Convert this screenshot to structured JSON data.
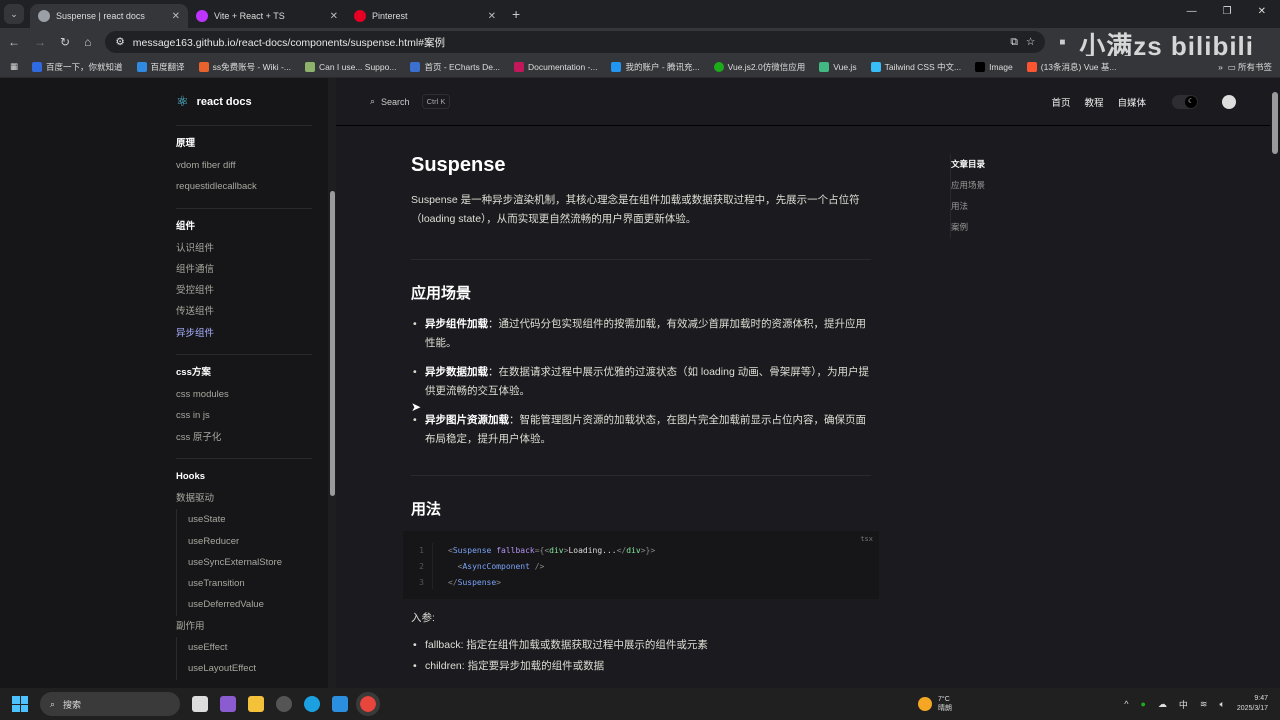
{
  "browser": {
    "tabs": [
      {
        "title": "Suspense | react docs",
        "active": true,
        "color": "#9aa0a6"
      },
      {
        "title": "Vite + React + TS",
        "active": false,
        "color": "#bd34fe"
      },
      {
        "title": "Pinterest",
        "active": false,
        "color": "#e60023"
      }
    ],
    "url": "message163.github.io/react-docs/components/suspense.html#案例",
    "bookmarks": [
      {
        "label": "百度一下，你就知道",
        "color": "#2f6ae0"
      },
      {
        "label": "百度翻译",
        "color": "#2f8ae0"
      },
      {
        "label": "ss免费账号 - Wiki -...",
        "color": "#e8632b"
      },
      {
        "label": "Can I use... Suppo...",
        "color": "#8cb369"
      },
      {
        "label": "首页 - ECharts De...",
        "color": "#3b6fd0"
      },
      {
        "label": "Documentation -...",
        "color": "#c2185b"
      },
      {
        "label": "我的账户 - 腾讯充...",
        "color": "#2196f3"
      },
      {
        "label": "Vue.js2.0仿微信应用",
        "color": "#1aad19"
      },
      {
        "label": "Vue.js",
        "color": "#42b883"
      },
      {
        "label": "Tailwind CSS 中文...",
        "color": "#38bdf8"
      },
      {
        "label": "Image",
        "color": "#000000"
      },
      {
        "label": "(13条消息) Vue 基...",
        "color": "#fc5531"
      }
    ],
    "all_bookmarks": "所有书签",
    "watermark": "小满zs bilibili"
  },
  "sidebar": {
    "logo": "react docs",
    "groups": [
      {
        "title": "原理",
        "items": [
          "vdom fiber diff",
          "requestidlecallback"
        ]
      },
      {
        "title": "组件",
        "items": [
          "认识组件",
          "组件通信",
          "受控组件",
          "传送组件",
          "异步组件"
        ],
        "active": "异步组件"
      },
      {
        "title": "css方案",
        "items": [
          "css modules",
          "css in js",
          "css 原子化"
        ]
      }
    ],
    "hooks": {
      "title": "Hooks",
      "sub1": "数据驱动",
      "items1": [
        "useState",
        "useReducer",
        "useSyncExternalStore",
        "useTransition",
        "useDeferredValue"
      ],
      "sub2": "副作用",
      "items2": [
        "useEffect",
        "useLayoutEffect"
      ]
    }
  },
  "nav": {
    "search": "Search",
    "shortcut": "Ctrl K",
    "links": [
      "首页",
      "教程",
      "自媒体"
    ]
  },
  "article": {
    "title": "Suspense",
    "intro": "Suspense 是一种异步渲染机制，其核心理念是在组件加载或数据获取过程中，先展示一个占位符（loading state），从而实现更自然流畅的用户界面更新体验。",
    "h_scenarios": "应用场景",
    "scenarios": [
      {
        "term": "异步组件加载",
        "desc": "：通过代码分包实现组件的按需加载，有效减少首屏加载时的资源体积，提升应用性能。"
      },
      {
        "term": "异步数据加载",
        "desc": "：在数据请求过程中展示优雅的过渡状态（如 loading 动画、骨架屏等），为用户提供更流畅的交互体验。"
      },
      {
        "term": "异步图片资源加载",
        "desc": "：智能管理图片资源的加载状态，在图片完全加载前显示占位内容，确保页面布局稳定，提升用户体验。"
      }
    ],
    "h_usage": "用法",
    "code_lang": "tsx",
    "code_lines": [
      "1",
      "2",
      "3"
    ],
    "params_label": "入参:",
    "params": [
      "fallback: 指定在组件加载或数据获取过程中展示的组件或元素",
      "children: 指定要异步加载的组件或数据"
    ]
  },
  "outline": {
    "title": "文章目录",
    "items": [
      "应用场景",
      "用法",
      "案例"
    ]
  },
  "taskbar": {
    "search": "搜索",
    "temp": "7°C",
    "weather": "晴朗",
    "ime": "中",
    "time": "9:47",
    "date": "2025/3/17"
  }
}
